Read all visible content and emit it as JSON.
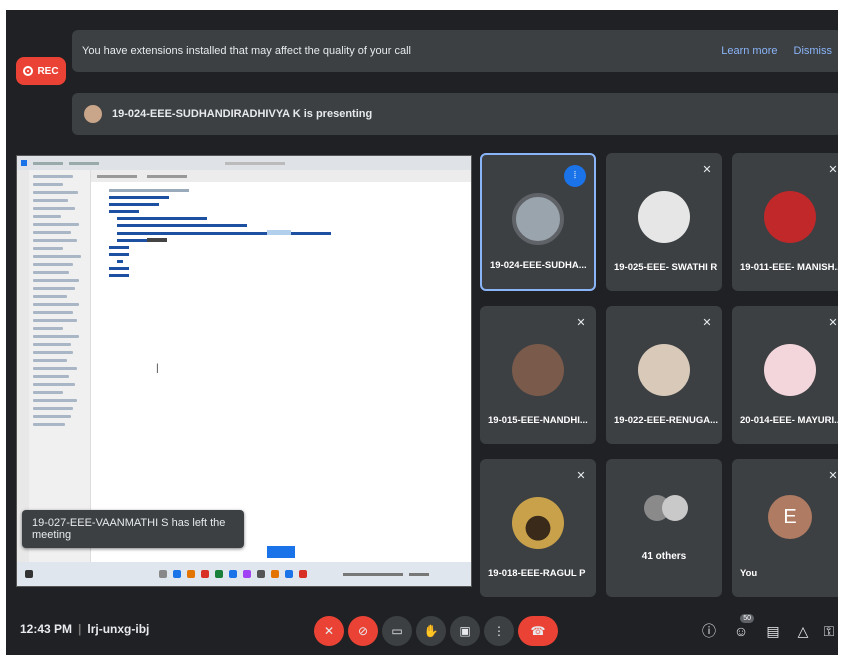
{
  "banner": {
    "extensions_message": "You have extensions installed that may affect the quality of your call",
    "learn_more": "Learn more",
    "dismiss": "Dismiss"
  },
  "rec_label": "REC",
  "presenting": "19-024-EEE-SUDHANDIRADHIVYA K is presenting",
  "toast": "19-027-EEE-VAANMATHI S has left the meeting",
  "participants": [
    {
      "name": "19-024-EEE-SUDHA...",
      "state": "speaking",
      "avatar_color": "#9aa4ad"
    },
    {
      "name": "19-025-EEE- SWATHI R",
      "state": "muted",
      "avatar_color": "#e6e6e6"
    },
    {
      "name": "19-011-EEE- MANISH...",
      "state": "muted",
      "avatar_color": "#c0282a"
    },
    {
      "name": "19-015-EEE-NANDHI...",
      "state": "muted",
      "avatar_color": "#7a5a4b"
    },
    {
      "name": "19-022-EEE-RENUGA...",
      "state": "muted",
      "avatar_color": "#d8c9b9"
    },
    {
      "name": "20-014-EEE- MAYURI...",
      "state": "muted",
      "avatar_color": "#f3d6dc"
    },
    {
      "name": "19-018-EEE-RAGUL P",
      "state": "muted",
      "avatar_color": "#c8a14a"
    },
    {
      "others_count_label": "41 others"
    },
    {
      "name": "You",
      "initial": "E",
      "state": "muted",
      "avatar_color": "#b07b63"
    }
  ],
  "footer": {
    "time": "12:43 PM",
    "meeting_code": "lrj-unxg-ibj",
    "participants_badge": "50"
  },
  "colors": {
    "background": "#202124",
    "surface": "#3c4043",
    "danger": "#ea4335",
    "accent": "#8ab4f8"
  }
}
